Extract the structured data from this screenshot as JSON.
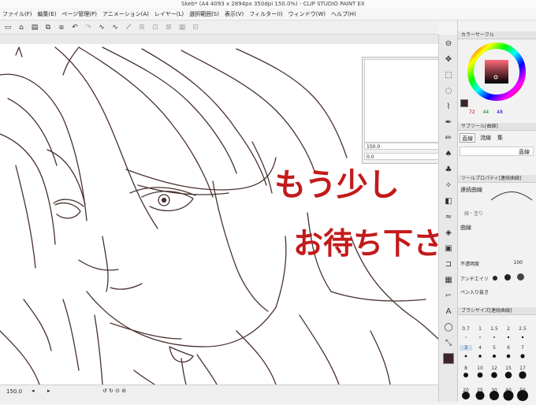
{
  "window": {
    "title": "Skeb* (A4 4093 x 2894px 350dpi 150.0%) - CLIP STUDIO PAINT EX"
  },
  "menu": [
    "ファイル(F)",
    "編集(E)",
    "ページ管理(P)",
    "アニメーション(A)",
    "レイヤー(L)",
    "選択範囲(S)",
    "表示(V)",
    "フィルター(I)",
    "ウィンドウ(W)",
    "ヘルプ(H)"
  ],
  "navigator": {
    "zoom": "150.0",
    "angle": "0.0"
  },
  "color_panel": {
    "title": "カラーサークル",
    "r": "72",
    "g": "44",
    "b": "48",
    "fg_color": "#3b2528",
    "bg_color": "#ffffff"
  },
  "subtool": {
    "title": "サブツール[曲線]",
    "tabs": [
      "直線",
      "流線",
      "集"
    ],
    "item": "直線"
  },
  "tool_property": {
    "title": "ツールプロパティ[連続曲線]",
    "name": "連続曲線",
    "line_fill": "線・塗り",
    "curve": "曲線",
    "opacity_label": "不透明度",
    "opacity": "100",
    "antialias": "アンチエイリ",
    "thickness": "ペン入り抜き"
  },
  "brush_size": {
    "title": "ブラシサイズ[連続曲線]",
    "sizes": [
      "0.7",
      "1",
      "1.5",
      "2",
      "2.5",
      "3",
      "4",
      "5",
      "6",
      "7",
      "8",
      "10",
      "12",
      "15",
      "17",
      "20",
      "25",
      "30",
      "40",
      "50"
    ]
  },
  "canvas": {
    "message_line1": "もう少し",
    "message_line2": "お待ち下さい…"
  },
  "statusbar": {
    "zoom": "150.0"
  },
  "accent_red": "#c41a1a"
}
